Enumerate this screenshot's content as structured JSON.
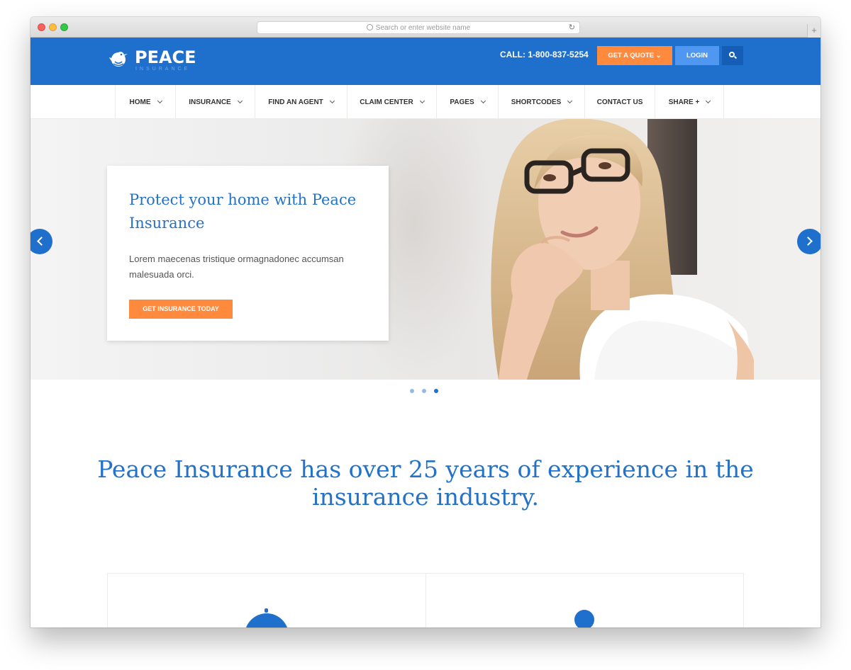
{
  "browser": {
    "url_placeholder": "Search or enter website name",
    "new_tab": "+"
  },
  "header": {
    "logo_text": "PEACE",
    "logo_subtext": "INSURANCE",
    "call": "CALL: 1-800-837-5254",
    "quote_label": "GET A QUOTE",
    "login_label": "LOGIN"
  },
  "nav": {
    "items": [
      {
        "label": "HOME",
        "dropdown": true
      },
      {
        "label": "INSURANCE",
        "dropdown": true
      },
      {
        "label": "FIND AN AGENT",
        "dropdown": true
      },
      {
        "label": "CLAIM CENTER",
        "dropdown": true
      },
      {
        "label": "PAGES",
        "dropdown": true
      },
      {
        "label": "SHORTCODES",
        "dropdown": true
      },
      {
        "label": "CONTACT US",
        "dropdown": false
      },
      {
        "label": "SHARE +",
        "dropdown": true
      }
    ]
  },
  "hero": {
    "title": "Protect your home with Peace Insurance",
    "text": "Lorem maecenas tristique ormagnadonec accumsan malesuada orci.",
    "button": "GET INSURANCE TODAY",
    "slides": 3,
    "active_slide": 3
  },
  "headline": "Peace Insurance has over 25 years of experience in the insurance industry.",
  "colors": {
    "brand_blue": "#1f6fcc",
    "accent_orange": "#ff8a3d",
    "login_blue": "#4f97f0"
  }
}
